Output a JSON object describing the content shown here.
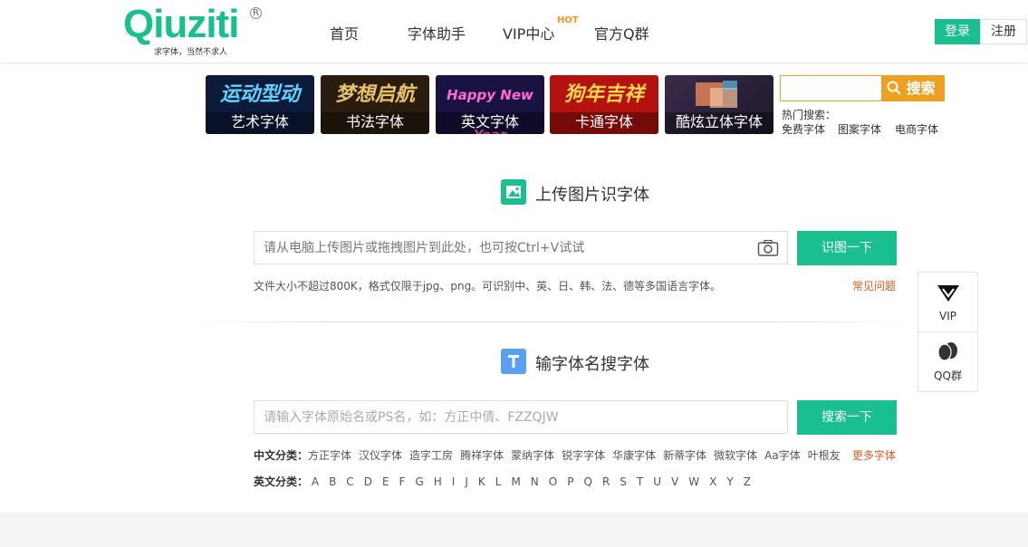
{
  "header": {
    "logo_text": "Qiuziti",
    "logo_reg": "R",
    "logo_slogan": "求字体，当然不求人",
    "nav": [
      "首页",
      "字体助手",
      "VIP中心",
      "官方Q群"
    ],
    "hot_badge": "HOT",
    "login": "登录",
    "register": "注册"
  },
  "categories": [
    {
      "label": "艺术字体",
      "art": "运动型动",
      "bg": "#0d1b3a",
      "color": "#5fd3ff"
    },
    {
      "label": "书法字体",
      "art": "梦想启航",
      "bg": "#2a1d0f",
      "color": "#e8c26a"
    },
    {
      "label": "英文字体",
      "art": "Happy New Year",
      "bg": "#1a1240",
      "color": "#ff6ad5"
    },
    {
      "label": "卡通字体",
      "art": "狗年吉祥",
      "bg": "#b3120f",
      "color": "#ffd84a"
    },
    {
      "label": "酷炫立体字体",
      "art": "",
      "bg": "#2b2236",
      "color": "#ff9a6a"
    }
  ],
  "search": {
    "button": "搜索",
    "hot_title": "热门搜索：",
    "hot_links": [
      "免费字体",
      "图案字体",
      "电商字体"
    ]
  },
  "upload_section": {
    "title": "上传图片识字体",
    "placeholder": "请从电脑上传图片或拖拽图片到此处，也可按Ctrl+V试试",
    "button": "识图一下",
    "note": "文件大小不超过800K，格式仅限于jpg、png。可识别中、英、日、韩、法、德等多国语言字体。",
    "faq": "常见问题"
  },
  "name_section": {
    "title": "输字体名搜字体",
    "placeholder": "请输入字体原始名或PS名，如：方正中倩、FZZQJW",
    "button": "搜索一下",
    "cn_label": "中文分类：",
    "cn_items": [
      "方正字体",
      "汉仪字体",
      "造字工房",
      "腾祥字体",
      "蒙纳字体",
      "锐字字体",
      "华康字体",
      "新蒂字体",
      "微软字体",
      "Aa字体",
      "叶根友"
    ],
    "more": "更多字体",
    "en_label": "英文分类：",
    "en_items": [
      "A",
      "B",
      "C",
      "D",
      "E",
      "F",
      "G",
      "H",
      "I",
      "J",
      "K",
      "L",
      "M",
      "N",
      "O",
      "P",
      "Q",
      "R",
      "S",
      "T",
      "U",
      "V",
      "W",
      "X",
      "Y",
      "Z"
    ]
  },
  "sidebar": {
    "vip": "VIP",
    "qq": "QQ群"
  },
  "colors": {
    "accent": "#19bf8f",
    "orange": "#f0a020",
    "link_red": "#e35a1c"
  }
}
